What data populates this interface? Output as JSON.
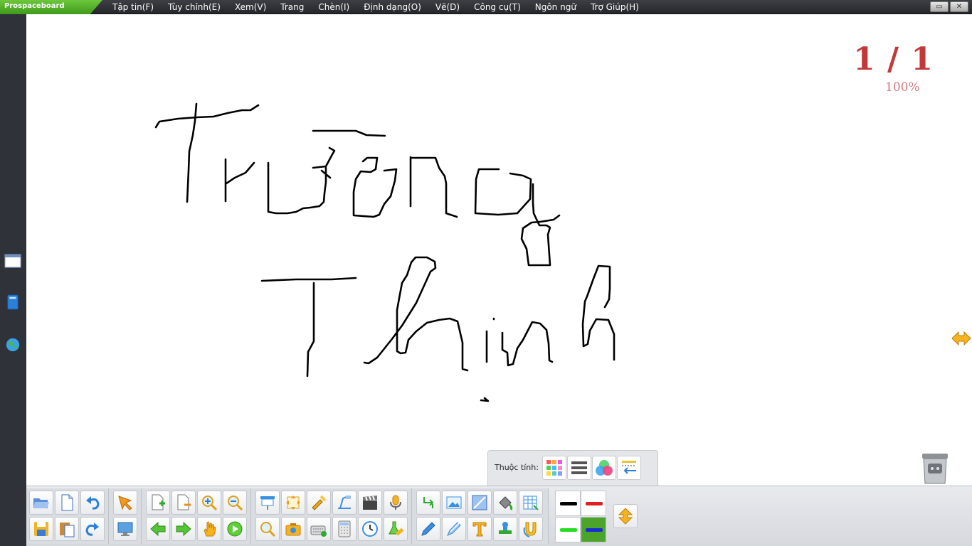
{
  "app": {
    "brand": "Prospaceboard"
  },
  "menu": [
    "Tập tin(F)",
    "Tùy chỉnh(E)",
    "Xem(V)",
    "Trang",
    "Chèn(I)",
    "Định dạng(O)",
    "Vẽ(D)",
    "Công cụ(T)",
    "Ngôn ngữ",
    "Trợ Giúp(H)"
  ],
  "window_controls": {
    "restore": "▭",
    "close": "✕"
  },
  "board": {
    "page_indicator": "1 / 1",
    "zoom": "100%",
    "ink_color": "#000000"
  },
  "properties": {
    "label": "Thuộc tính:"
  },
  "palette": {
    "colors": [
      "#000000",
      "#e02020",
      "#22dd22",
      "#1a2bd6"
    ],
    "selected": "#1a2bd6"
  }
}
